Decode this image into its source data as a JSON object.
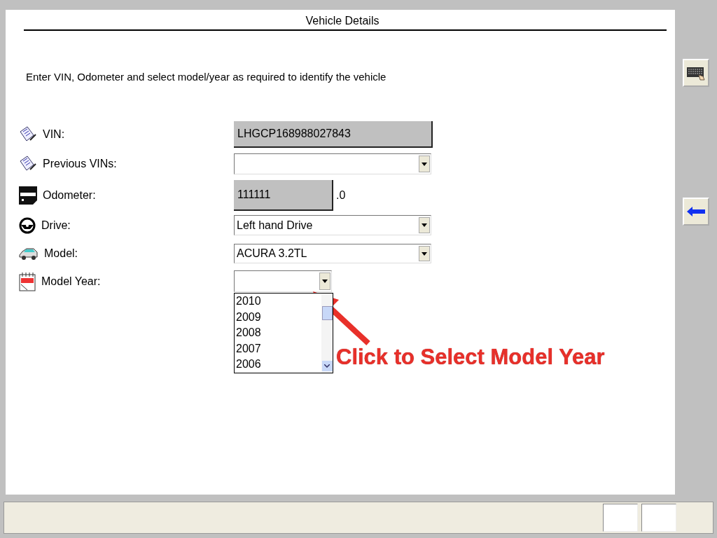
{
  "window": {
    "title": "Vehicle Details"
  },
  "instruction": "Enter VIN, Odometer and select model/year as required to identify the vehicle",
  "fields": [
    {
      "kind": "text",
      "label": "VIN:",
      "value": "LHGCP168988027843"
    },
    {
      "kind": "dropdown",
      "label": "Previous VINs:"
    },
    {
      "kind": "odometer",
      "label": "Odometer:",
      "value": "111111",
      "suffix": ".0"
    },
    {
      "kind": "dropdown",
      "label": "Drive:",
      "value": "Left hand Drive"
    },
    {
      "kind": "dropdown",
      "label": "Model:",
      "value": "ACURA 3.2TL"
    },
    {
      "kind": "year",
      "label": "Model Year:",
      "expanded": true,
      "options": [
        "2010",
        "2009",
        "2008",
        "2007",
        "2006"
      ]
    }
  ],
  "annotation": "Click to Select Model Year"
}
